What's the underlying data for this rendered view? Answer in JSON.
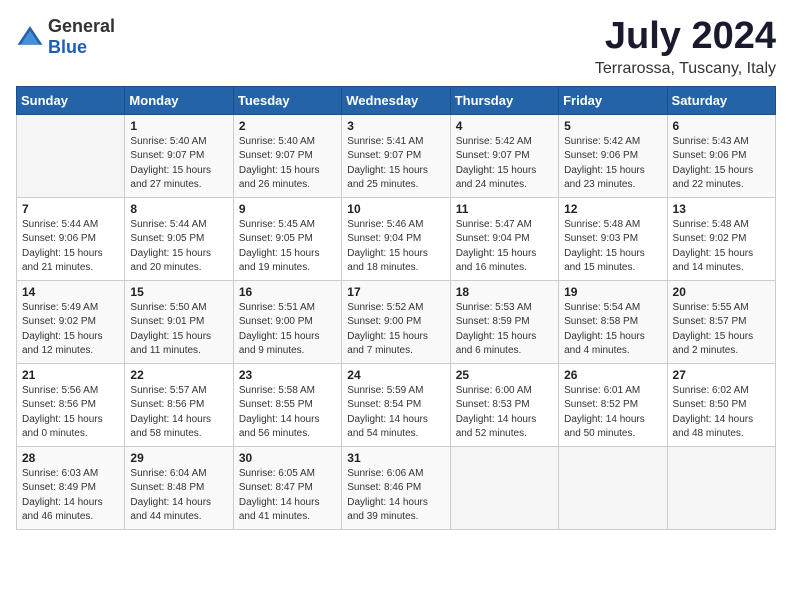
{
  "logo": {
    "general": "General",
    "blue": "Blue"
  },
  "title": "July 2024",
  "location": "Terrarossa, Tuscany, Italy",
  "days_of_week": [
    "Sunday",
    "Monday",
    "Tuesday",
    "Wednesday",
    "Thursday",
    "Friday",
    "Saturday"
  ],
  "weeks": [
    [
      {
        "day": "",
        "sunrise": "",
        "sunset": "",
        "daylight": ""
      },
      {
        "day": "1",
        "sunrise": "Sunrise: 5:40 AM",
        "sunset": "Sunset: 9:07 PM",
        "daylight": "Daylight: 15 hours and 27 minutes."
      },
      {
        "day": "2",
        "sunrise": "Sunrise: 5:40 AM",
        "sunset": "Sunset: 9:07 PM",
        "daylight": "Daylight: 15 hours and 26 minutes."
      },
      {
        "day": "3",
        "sunrise": "Sunrise: 5:41 AM",
        "sunset": "Sunset: 9:07 PM",
        "daylight": "Daylight: 15 hours and 25 minutes."
      },
      {
        "day": "4",
        "sunrise": "Sunrise: 5:42 AM",
        "sunset": "Sunset: 9:07 PM",
        "daylight": "Daylight: 15 hours and 24 minutes."
      },
      {
        "day": "5",
        "sunrise": "Sunrise: 5:42 AM",
        "sunset": "Sunset: 9:06 PM",
        "daylight": "Daylight: 15 hours and 23 minutes."
      },
      {
        "day": "6",
        "sunrise": "Sunrise: 5:43 AM",
        "sunset": "Sunset: 9:06 PM",
        "daylight": "Daylight: 15 hours and 22 minutes."
      }
    ],
    [
      {
        "day": "7",
        "sunrise": "Sunrise: 5:44 AM",
        "sunset": "Sunset: 9:06 PM",
        "daylight": "Daylight: 15 hours and 21 minutes."
      },
      {
        "day": "8",
        "sunrise": "Sunrise: 5:44 AM",
        "sunset": "Sunset: 9:05 PM",
        "daylight": "Daylight: 15 hours and 20 minutes."
      },
      {
        "day": "9",
        "sunrise": "Sunrise: 5:45 AM",
        "sunset": "Sunset: 9:05 PM",
        "daylight": "Daylight: 15 hours and 19 minutes."
      },
      {
        "day": "10",
        "sunrise": "Sunrise: 5:46 AM",
        "sunset": "Sunset: 9:04 PM",
        "daylight": "Daylight: 15 hours and 18 minutes."
      },
      {
        "day": "11",
        "sunrise": "Sunrise: 5:47 AM",
        "sunset": "Sunset: 9:04 PM",
        "daylight": "Daylight: 15 hours and 16 minutes."
      },
      {
        "day": "12",
        "sunrise": "Sunrise: 5:48 AM",
        "sunset": "Sunset: 9:03 PM",
        "daylight": "Daylight: 15 hours and 15 minutes."
      },
      {
        "day": "13",
        "sunrise": "Sunrise: 5:48 AM",
        "sunset": "Sunset: 9:02 PM",
        "daylight": "Daylight: 15 hours and 14 minutes."
      }
    ],
    [
      {
        "day": "14",
        "sunrise": "Sunrise: 5:49 AM",
        "sunset": "Sunset: 9:02 PM",
        "daylight": "Daylight: 15 hours and 12 minutes."
      },
      {
        "day": "15",
        "sunrise": "Sunrise: 5:50 AM",
        "sunset": "Sunset: 9:01 PM",
        "daylight": "Daylight: 15 hours and 11 minutes."
      },
      {
        "day": "16",
        "sunrise": "Sunrise: 5:51 AM",
        "sunset": "Sunset: 9:00 PM",
        "daylight": "Daylight: 15 hours and 9 minutes."
      },
      {
        "day": "17",
        "sunrise": "Sunrise: 5:52 AM",
        "sunset": "Sunset: 9:00 PM",
        "daylight": "Daylight: 15 hours and 7 minutes."
      },
      {
        "day": "18",
        "sunrise": "Sunrise: 5:53 AM",
        "sunset": "Sunset: 8:59 PM",
        "daylight": "Daylight: 15 hours and 6 minutes."
      },
      {
        "day": "19",
        "sunrise": "Sunrise: 5:54 AM",
        "sunset": "Sunset: 8:58 PM",
        "daylight": "Daylight: 15 hours and 4 minutes."
      },
      {
        "day": "20",
        "sunrise": "Sunrise: 5:55 AM",
        "sunset": "Sunset: 8:57 PM",
        "daylight": "Daylight: 15 hours and 2 minutes."
      }
    ],
    [
      {
        "day": "21",
        "sunrise": "Sunrise: 5:56 AM",
        "sunset": "Sunset: 8:56 PM",
        "daylight": "Daylight: 15 hours and 0 minutes."
      },
      {
        "day": "22",
        "sunrise": "Sunrise: 5:57 AM",
        "sunset": "Sunset: 8:56 PM",
        "daylight": "Daylight: 14 hours and 58 minutes."
      },
      {
        "day": "23",
        "sunrise": "Sunrise: 5:58 AM",
        "sunset": "Sunset: 8:55 PM",
        "daylight": "Daylight: 14 hours and 56 minutes."
      },
      {
        "day": "24",
        "sunrise": "Sunrise: 5:59 AM",
        "sunset": "Sunset: 8:54 PM",
        "daylight": "Daylight: 14 hours and 54 minutes."
      },
      {
        "day": "25",
        "sunrise": "Sunrise: 6:00 AM",
        "sunset": "Sunset: 8:53 PM",
        "daylight": "Daylight: 14 hours and 52 minutes."
      },
      {
        "day": "26",
        "sunrise": "Sunrise: 6:01 AM",
        "sunset": "Sunset: 8:52 PM",
        "daylight": "Daylight: 14 hours and 50 minutes."
      },
      {
        "day": "27",
        "sunrise": "Sunrise: 6:02 AM",
        "sunset": "Sunset: 8:50 PM",
        "daylight": "Daylight: 14 hours and 48 minutes."
      }
    ],
    [
      {
        "day": "28",
        "sunrise": "Sunrise: 6:03 AM",
        "sunset": "Sunset: 8:49 PM",
        "daylight": "Daylight: 14 hours and 46 minutes."
      },
      {
        "day": "29",
        "sunrise": "Sunrise: 6:04 AM",
        "sunset": "Sunset: 8:48 PM",
        "daylight": "Daylight: 14 hours and 44 minutes."
      },
      {
        "day": "30",
        "sunrise": "Sunrise: 6:05 AM",
        "sunset": "Sunset: 8:47 PM",
        "daylight": "Daylight: 14 hours and 41 minutes."
      },
      {
        "day": "31",
        "sunrise": "Sunrise: 6:06 AM",
        "sunset": "Sunset: 8:46 PM",
        "daylight": "Daylight: 14 hours and 39 minutes."
      },
      {
        "day": "",
        "sunrise": "",
        "sunset": "",
        "daylight": ""
      },
      {
        "day": "",
        "sunrise": "",
        "sunset": "",
        "daylight": ""
      },
      {
        "day": "",
        "sunrise": "",
        "sunset": "",
        "daylight": ""
      }
    ]
  ]
}
